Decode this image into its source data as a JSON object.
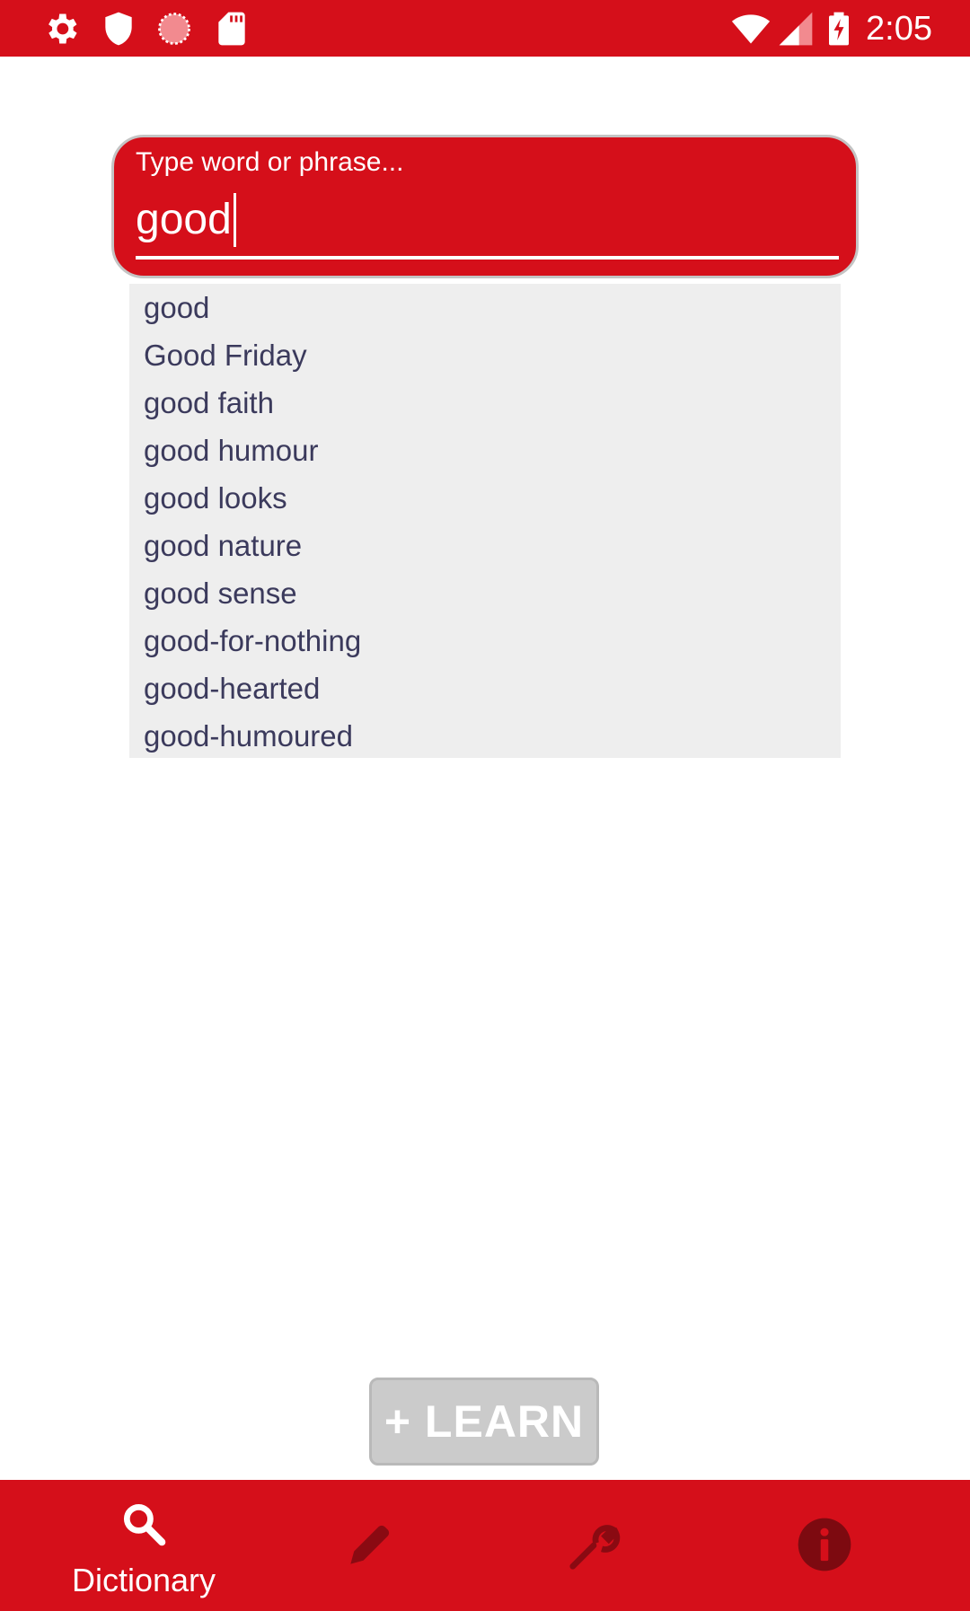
{
  "status_bar": {
    "time": "2:05",
    "left_icons": [
      "settings-icon",
      "shield-icon",
      "loading-circle-icon",
      "sd-card-icon"
    ],
    "right_icons": [
      "wifi-icon",
      "cell-signal-icon",
      "battery-charging-icon"
    ]
  },
  "search": {
    "label": "Type word or phrase...",
    "value": "good"
  },
  "suggestions": [
    "good",
    "Good Friday",
    "good faith",
    "good humour",
    "good looks",
    "good nature",
    "good sense",
    "good-for-nothing",
    "good-hearted",
    "good-humoured"
  ],
  "learn_button": {
    "label": "+ LEARN"
  },
  "bottom_nav": {
    "items": [
      {
        "label": "Dictionary",
        "icon": "search-icon",
        "active": true
      },
      {
        "label": "",
        "icon": "pencil-icon",
        "active": false
      },
      {
        "label": "",
        "icon": "wrench-icon",
        "active": false
      },
      {
        "label": "",
        "icon": "info-icon",
        "active": false
      }
    ]
  },
  "colors": {
    "primary": "#d50f1a",
    "suggestion_bg": "#eeeeee",
    "suggestion_text": "#3b3a5c",
    "inactive_icon": "#8a0a12"
  }
}
